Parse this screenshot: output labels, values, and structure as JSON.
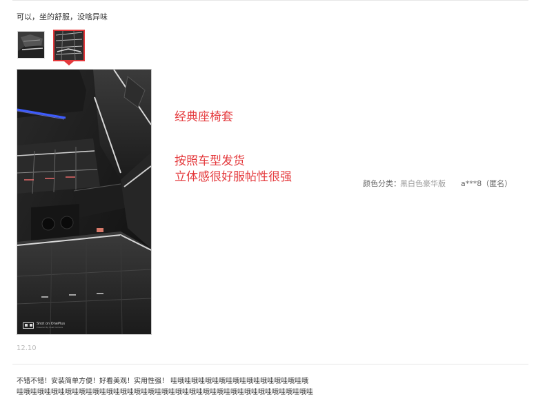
{
  "review1": {
    "text": "可以，坐的舒服，没啥异味",
    "captions": [
      "经典座椅套",
      "按照车型发货",
      "立体感很好服帖性很强"
    ],
    "color_label": "颜色分类：",
    "color_value": "黑白色豪华版",
    "user": "a***8（匿名）",
    "date": "12.10",
    "photo_watermark": "Shot on OnePlus",
    "photo_watermark_sub": "Powered by Dual Camera"
  },
  "review2": {
    "line1": "不错不错！安装简单方便！好看美观！实用性强！ 哇哦哇哦哇哦哇哦哇哦哇哦哇哦哇哦哇哦哇哦",
    "line2": "哇哦哇哦哇哦哇哦哇哦哇哦哇哦哇哦哇哦哇哦哇哦哇哦哇哦哇哦哇哦哇哦哇哦哇哦哇哦哇哦哇哦哇"
  },
  "colors": {
    "accent": "#e4393c"
  },
  "icons": {
    "thumb_pointer": "caret-down-icon",
    "camera_watermark": "camera-icon"
  }
}
